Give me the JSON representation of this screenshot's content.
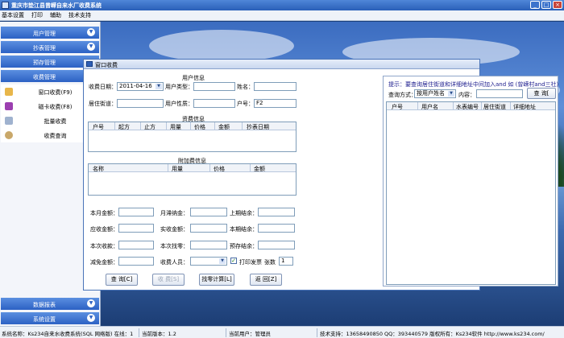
{
  "window": {
    "title": "重庆市垫江县曾嵘自来水厂收费系统",
    "buttons": [
      "_",
      "□",
      "×"
    ]
  },
  "menu": [
    "基本设置",
    "打印",
    "辅助",
    "技术支持"
  ],
  "sidebar": {
    "sections_top": [
      {
        "label": "用户管理"
      },
      {
        "label": "抄表管理"
      }
    ],
    "sub_headers": [
      {
        "label": "预存管理"
      },
      {
        "label": "收费管理"
      }
    ],
    "links": [
      {
        "label": "窗口收费(F9)",
        "icon": "pencil-icon"
      },
      {
        "label": "磁卡收费(F8)",
        "icon": "card-icon"
      },
      {
        "label": "批量收费",
        "icon": "batch-icon"
      },
      {
        "label": "收费查询",
        "icon": "query-icon"
      }
    ],
    "sections_bottom": [
      {
        "label": "数据报表"
      },
      {
        "label": "系统设置"
      }
    ]
  },
  "dialog": {
    "title": "窗口收费",
    "user_info_title": "用户信息",
    "fee_date_label": "收费日期：",
    "fee_date_value": "2011-04-16",
    "user_type_label": "用户类型：",
    "name_label": "姓名：",
    "street_label": "居住街道：",
    "user_nature_label": "用户性质：",
    "account_label": "户号：",
    "account_value": "F2",
    "fee_info_title": "资费信息",
    "fee_columns": [
      "户号",
      "起方",
      "止方",
      "用量",
      "价格",
      "金额",
      "抄表日期"
    ],
    "extra_info_title": "附加费信息",
    "extra_columns": [
      "名称",
      "用量",
      "价格",
      "金额"
    ],
    "summary": {
      "row1": [
        "本月金额：",
        "月滞纳金：",
        "上期结余："
      ],
      "row2": [
        "应收金额：",
        "实收金额：",
        "本期结余："
      ],
      "row3": [
        "本次收款：",
        "本次找零：",
        "预存结余："
      ],
      "row4_labels": [
        "减免金额：",
        "收费人员："
      ],
      "print_label": "打印发票",
      "copies_label": "张数",
      "copies_value": "1"
    },
    "buttons": [
      {
        "label": "查 询[C]",
        "disabled": false
      },
      {
        "label": "收 费[S]",
        "disabled": true
      },
      {
        "label": "找零计算[L]",
        "disabled": false
      },
      {
        "label": "返 回[Z]",
        "disabled": false
      }
    ],
    "right": {
      "hint": "提示：要查询居住街道和详细地址中间加入and 如 (曾嵘村and三社)",
      "query_mode_label": "查询方式：",
      "query_mode_value": "按用户姓名",
      "content_label": "内容：",
      "search_button": "查 询[",
      "columns": [
        "户号",
        "用户名",
        "水表编号",
        "居住街道",
        "详细地址"
      ]
    }
  },
  "status": [
    "系统名称：Ks234自来水收费系统(SQL 网络版) 在线：1",
    "当前版本：1.2",
    "当前用户：管理员",
    "技术支持：13658490850 QQ：393440579 版权所有：Ks234软件 http://www.ks234.com/"
  ]
}
